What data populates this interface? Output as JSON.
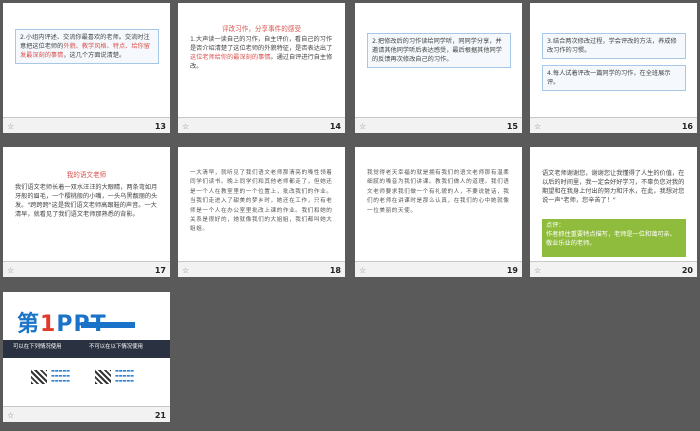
{
  "slides": [
    {
      "num": "13",
      "text_prefix": "2.小组内评述、交流你最喜欢的老师。交流时注意把这位老师的",
      "text_highlight": "外貌、教学风格、特点、给你留发最深刻的事情",
      "text_suffix": "，这几个方面说清楚。"
    },
    {
      "num": "14",
      "title": "评改习作，分享事件的感受",
      "text_prefix": "1.大声读一读自己的习作，自主评价，看自己的习作是否介绍清楚了这位老师的外貌特征，是否表达出了",
      "text_highlight": "这位老师给你的最深刻的事情",
      "text_suffix": "。通过自评进行自主修改。"
    },
    {
      "num": "15",
      "text": "2.把修改后的习作读给同学听，同同学分享，并邀请其他同学听后表达感受，最后根据其他同学的反馈再次修改自己的习作。"
    },
    {
      "num": "16",
      "box1": "3.结合两次修改过程，学会评改的方法，养成修改习作的习惯。",
      "box2": "4.每人试着评改一篇同学的习作，在全班展示评。"
    },
    {
      "num": "17",
      "title": "我的语文老师",
      "text": "我们语文老师长着一双水汪汪的大眼睛，两条弯如月牙般的眉毛，一个樱桃般的小嘴，一头乌黑靓丽的头发。\"跨跨跨\"这是我们语文老师高跟鞋的声音。一大清早，就看见了我们语文老师那熟悉的背影。"
    },
    {
      "num": "18",
      "text": "一大清早，就听见了我们语文老师那清亮的嗓性领着同学们读书。晚上同学们和其他老师都走了，但她还是一个人在教室里的一个位置上，批改我们的作业。当我们走进入了甜美的梦乡时，她还在工作，只有老师是一个人在办公室里批改上课的作业。我们和她的关系是很好的，她就像我们的大姐姐，我们都叫她大姐姐。"
    },
    {
      "num": "19",
      "text": "我觉得老天幸福的就是拥有我们的语文老师那有温柔细腻的嗓音为我们讲课。教我们做人的道理。我们语文老师要求我们做一个有礼貌的人，不要说脏话，我们的老师在讲课时是那么认真，在我们的心中她就像一位美丽的天使。"
    },
    {
      "num": "20",
      "text": "语文老师谢谢您，谢谢您让我懂得了人生的价值，在以后的时间里，我一定会好好学习，不辜负您对我的期望和在我身上付出的努力和汗水，在此，我想对您说一声\"老师，您辛苦了！\"",
      "comment_label": "点评：",
      "comment": "作者抓住重要特点描写，老师是一位和蔼可亲、敬业乐业的老师。"
    },
    {
      "num": "21",
      "logo_main": "第",
      "logo_one": "1",
      "logo_ppt": "PPT",
      "band_left": "可以在下列情况使用",
      "band_right": "不可以在以下情况使用"
    }
  ],
  "colors": {
    "background": "#5a5a5a",
    "highlight": "#d9534f",
    "green": "#8fbc3c"
  }
}
